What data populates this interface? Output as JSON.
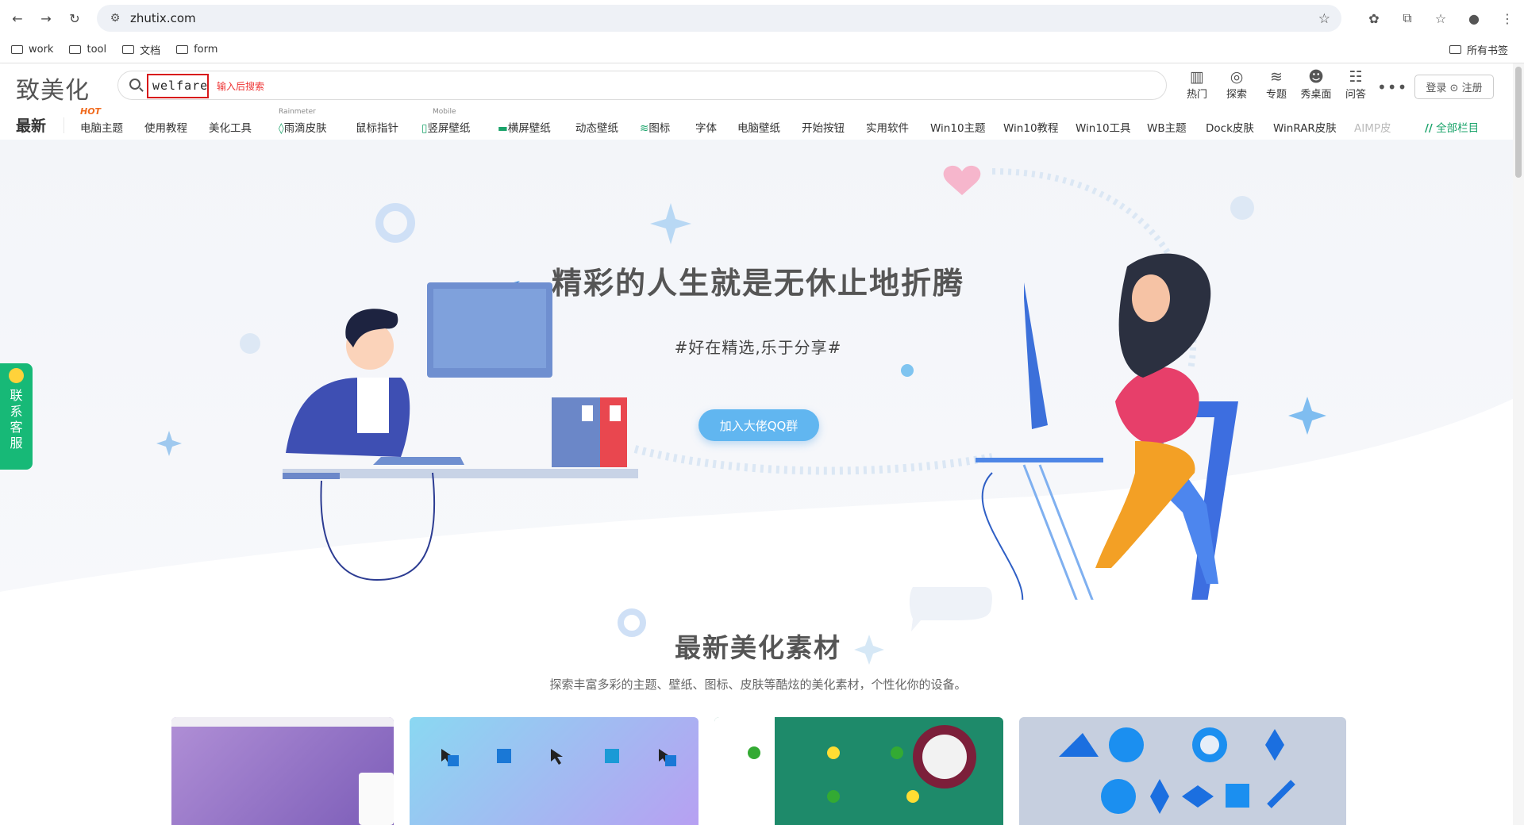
{
  "browser": {
    "url": "zhutix.com",
    "bookmarks": [
      "work",
      "tool",
      "文档",
      "form"
    ],
    "all_bookmarks": "所有书签"
  },
  "site": {
    "logo": "致美化",
    "search": {
      "value": "welfare",
      "hint": "输入后搜索"
    },
    "header_icons": [
      {
        "icon": "hot-chart-icon",
        "label": "热门"
      },
      {
        "icon": "compass-icon",
        "label": "探索"
      },
      {
        "icon": "layers-icon",
        "label": "专题"
      },
      {
        "icon": "user-showcase-icon",
        "label": "秀桌面"
      },
      {
        "icon": "qa-icon",
        "label": "问答"
      }
    ],
    "login_label": "登录 ⊙ 注册",
    "categories": {
      "latest": "最新",
      "items": [
        {
          "label": "电脑主题",
          "badge": "HOT"
        },
        {
          "label": "使用教程"
        },
        {
          "label": "美化工具"
        },
        {
          "label": "雨滴皮肤",
          "super": "Rainmeter"
        },
        {
          "label": "鼠标指针"
        },
        {
          "label": "竖屏壁纸",
          "super": "Mobile"
        },
        {
          "label": "横屏壁纸"
        },
        {
          "label": "动态壁纸"
        },
        {
          "label": "图标"
        },
        {
          "label": "字体"
        },
        {
          "label": "电脑壁纸"
        },
        {
          "label": "开始按钮"
        },
        {
          "label": "实用软件"
        },
        {
          "label": "Win10主题"
        },
        {
          "label": "Win10教程"
        },
        {
          "label": "Win10工具"
        },
        {
          "label": "WB主题"
        },
        {
          "label": "Dock皮肤"
        },
        {
          "label": "WinRAR皮肤"
        },
        {
          "label": "AIMP皮"
        }
      ],
      "all": "全部栏目"
    },
    "hero": {
      "title": "精彩的人生就是无休止地折腾",
      "subtitle": "#好在精选,乐于分享#",
      "button": "加入大佬QQ群"
    },
    "side_service": [
      "联",
      "系",
      "客",
      "服"
    ],
    "section": {
      "title": "最新美化素材",
      "subtitle": "探索丰富多彩的主题、壁纸、图标、皮肤等酷炫的美化素材，个性化你的设备。"
    }
  },
  "colors": {
    "accent_green": "#17b977",
    "button_blue": "#61b6f0",
    "search_outline": "#d8181a",
    "hot_orange": "#f06a1d"
  }
}
